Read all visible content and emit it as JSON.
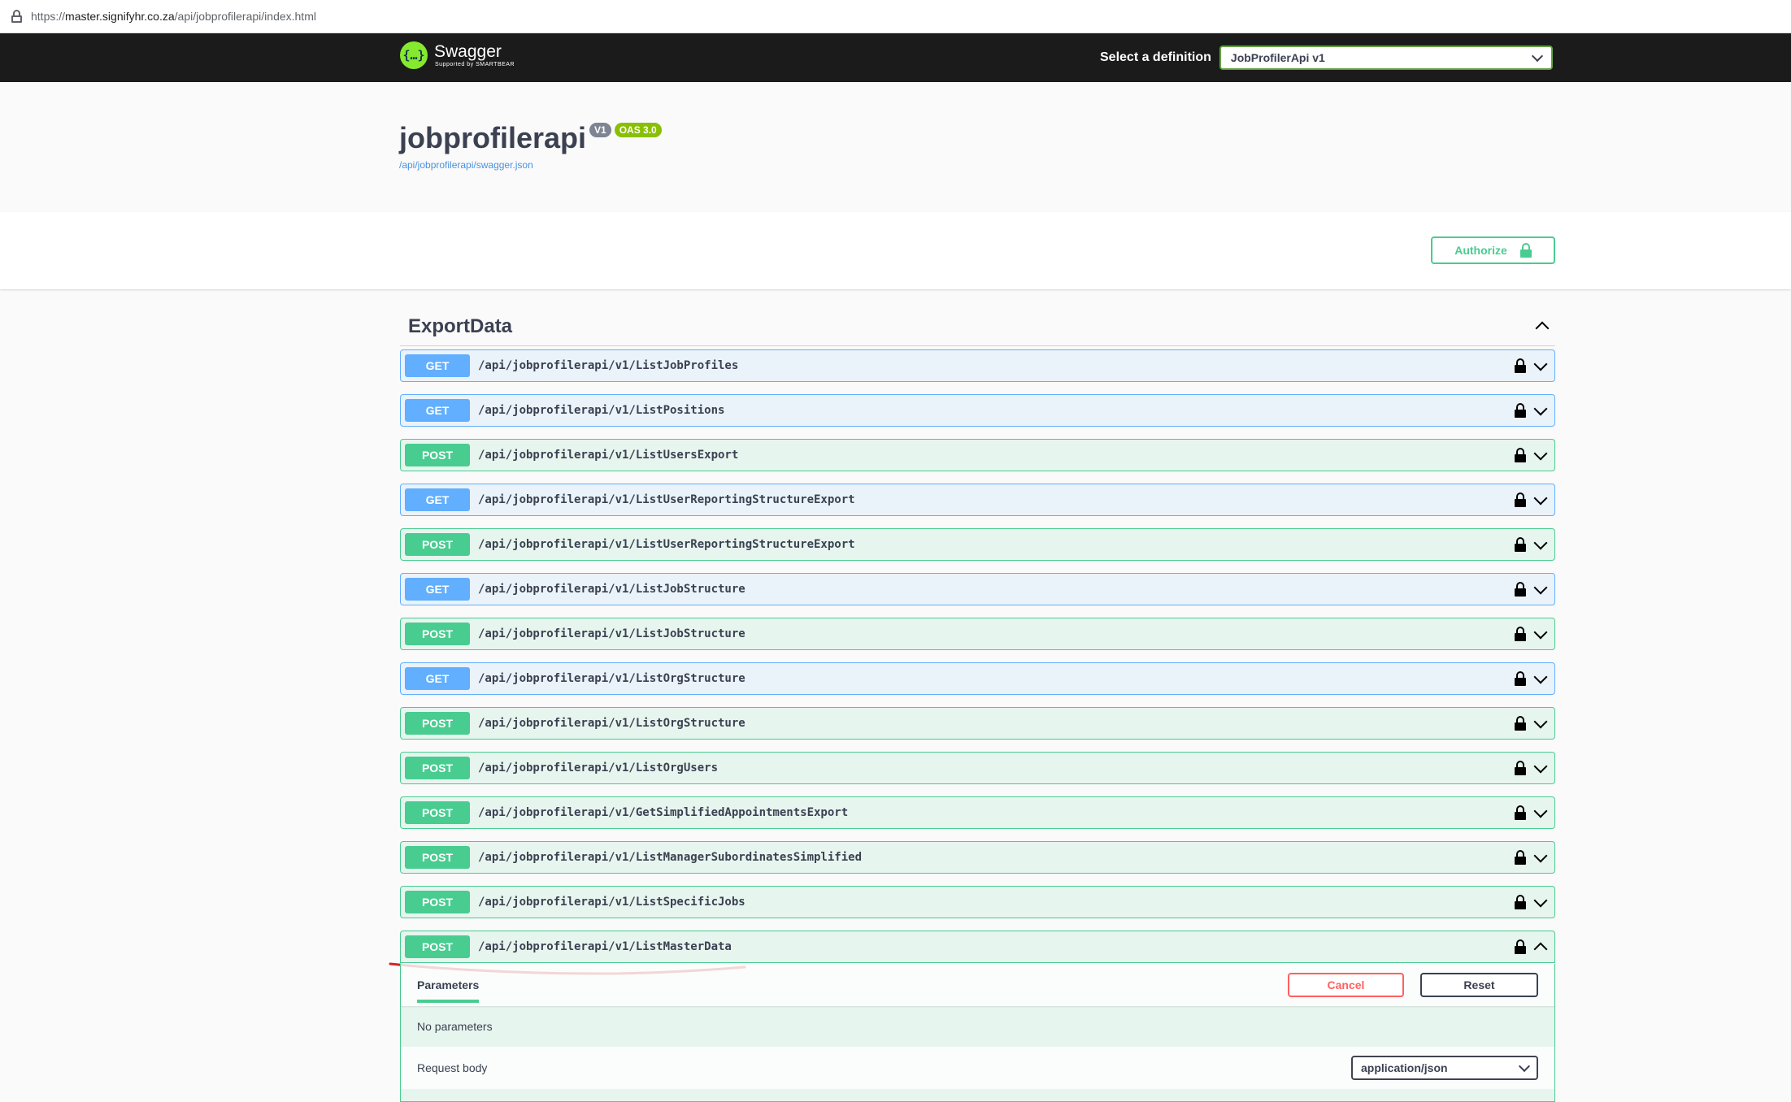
{
  "browser": {
    "url_prefix": "https://",
    "url_domain": "master.signifyhr.co.za",
    "url_path": "/api/jobprofilerapi/index.html"
  },
  "topbar": {
    "brand_name": "Swagger",
    "brand_sub": "Supported by SMARTBEAR",
    "definition_label": "Select a definition",
    "definition_value": "JobProfilerApi v1"
  },
  "info": {
    "title": "jobprofilerapi",
    "version_badge": "V1",
    "oas_badge": "OAS 3.0",
    "spec_url": "/api/jobprofilerapi/swagger.json"
  },
  "auth": {
    "label": "Authorize"
  },
  "tag": {
    "name": "ExportData"
  },
  "operations": [
    {
      "method": "GET",
      "path": "/api/jobprofilerapi/v1/ListJobProfiles"
    },
    {
      "method": "GET",
      "path": "/api/jobprofilerapi/v1/ListPositions"
    },
    {
      "method": "POST",
      "path": "/api/jobprofilerapi/v1/ListUsersExport"
    },
    {
      "method": "GET",
      "path": "/api/jobprofilerapi/v1/ListUserReportingStructureExport"
    },
    {
      "method": "POST",
      "path": "/api/jobprofilerapi/v1/ListUserReportingStructureExport"
    },
    {
      "method": "GET",
      "path": "/api/jobprofilerapi/v1/ListJobStructure"
    },
    {
      "method": "POST",
      "path": "/api/jobprofilerapi/v1/ListJobStructure"
    },
    {
      "method": "GET",
      "path": "/api/jobprofilerapi/v1/ListOrgStructure"
    },
    {
      "method": "POST",
      "path": "/api/jobprofilerapi/v1/ListOrgStructure"
    },
    {
      "method": "POST",
      "path": "/api/jobprofilerapi/v1/ListOrgUsers"
    },
    {
      "method": "POST",
      "path": "/api/jobprofilerapi/v1/GetSimplifiedAppointmentsExport"
    },
    {
      "method": "POST",
      "path": "/api/jobprofilerapi/v1/ListManagerSubordinatesSimplified"
    },
    {
      "method": "POST",
      "path": "/api/jobprofilerapi/v1/ListSpecificJobs"
    },
    {
      "method": "POST",
      "path": "/api/jobprofilerapi/v1/ListMasterData"
    }
  ],
  "expanded": {
    "tab_label": "Parameters",
    "cancel_label": "Cancel",
    "reset_label": "Reset",
    "no_params": "No parameters",
    "request_body_label": "Request body",
    "content_type": "application/json"
  },
  "colors": {
    "get": "#61affe",
    "post": "#49cc90",
    "annotation": "#d2232a"
  },
  "icons": {
    "row_lock": "padlock-icon",
    "row_toggle": "chevron-icon",
    "auth_lock": "padlock-icon"
  }
}
